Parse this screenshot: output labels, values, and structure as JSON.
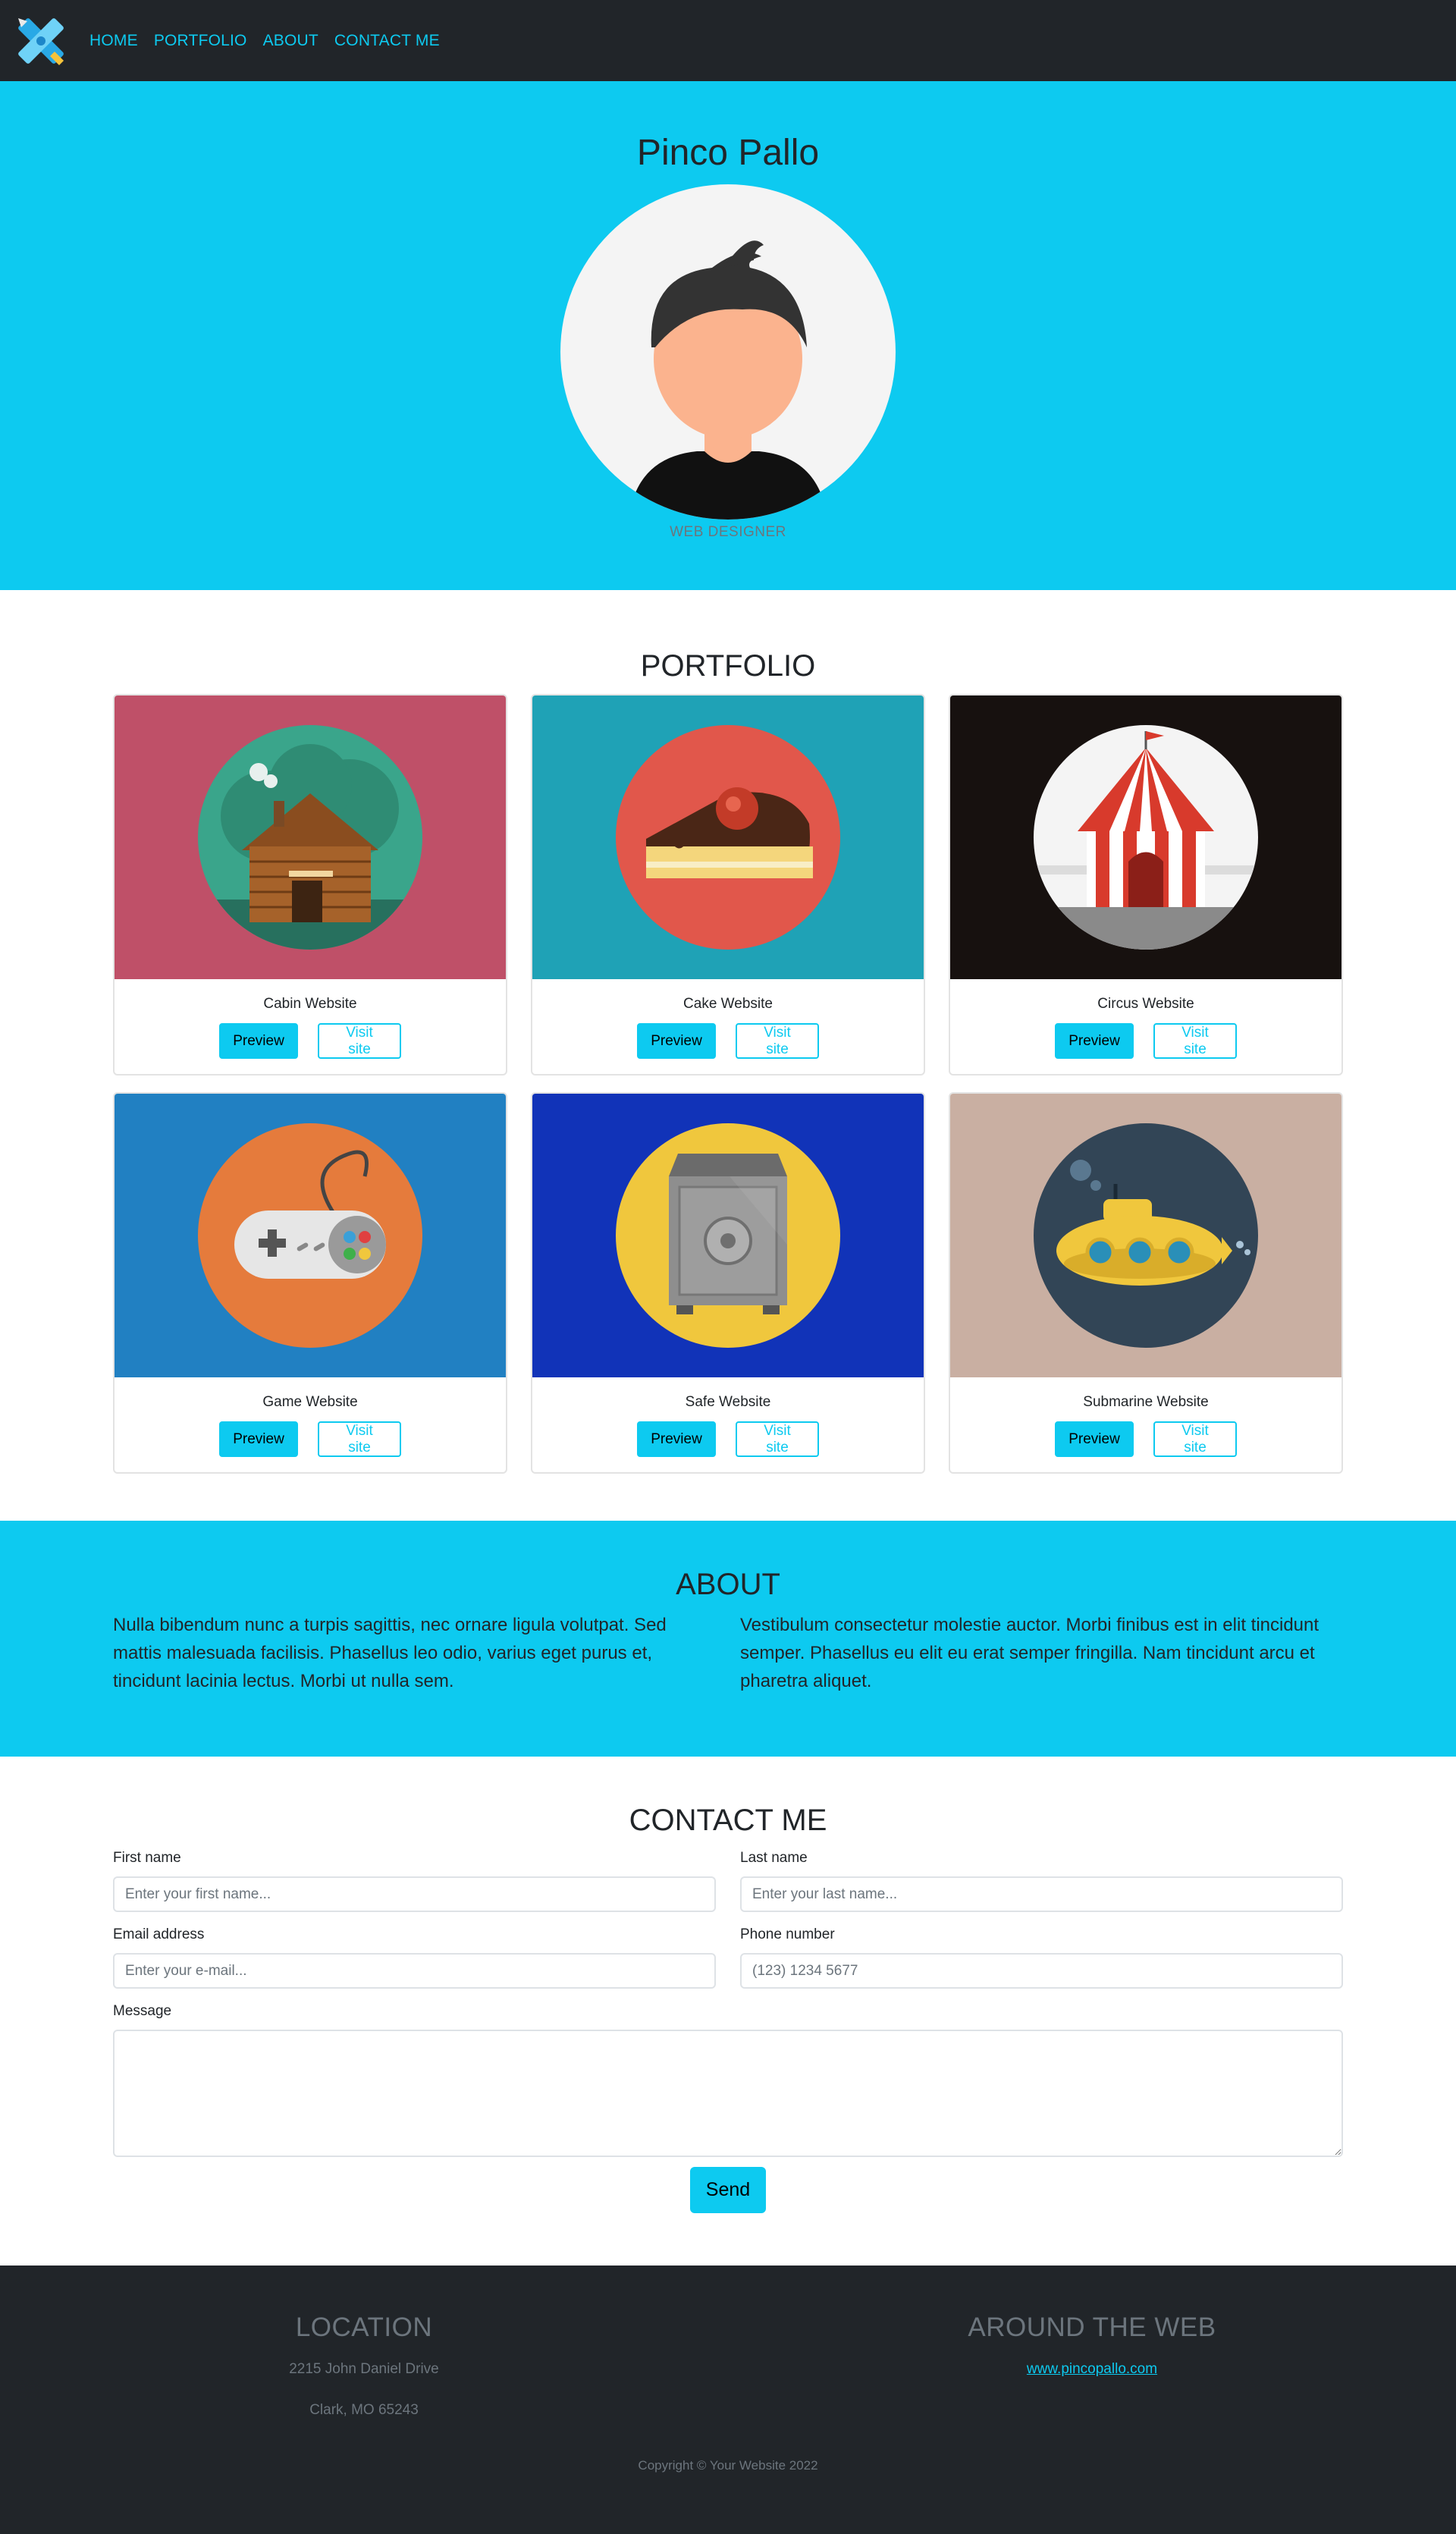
{
  "nav": {
    "logo": "design-tools-icon",
    "items": [
      "HOME",
      "PORTFOLIO",
      "ABOUT",
      "CONTACT ME"
    ]
  },
  "hero": {
    "name": "Pinco Pallo",
    "subtitle": "WEB DESIGNER",
    "avatar": "person-avatar-icon"
  },
  "portfolio": {
    "title": "PORTFOLIO",
    "preview_label": "Preview",
    "visit_label": "Visit site",
    "items": [
      {
        "title": "Cabin Website",
        "icon": "log-cabin-icon",
        "bg": "#bf5068",
        "circle": "#3aa58b"
      },
      {
        "title": "Cake Website",
        "icon": "cake-slice-icon",
        "bg": "#1fa2b6",
        "circle": "#e1574b"
      },
      {
        "title": "Circus Website",
        "icon": "circus-tent-icon",
        "bg": "#17110f",
        "circle": "#f4f4f4"
      },
      {
        "title": "Game Website",
        "icon": "game-controller-icon",
        "bg": "#2180c2",
        "circle": "#e57b3c"
      },
      {
        "title": "Safe Website",
        "icon": "safe-icon",
        "bg": "#1133b8",
        "circle": "#f0c73d"
      },
      {
        "title": "Submarine Website",
        "icon": "submarine-icon",
        "bg": "#c9afa2",
        "circle": "#324556"
      }
    ]
  },
  "about": {
    "title": "ABOUT",
    "left": "Nulla bibendum nunc a turpis sagittis, nec ornare ligula volutpat. Sed mattis malesuada facilisis. Phasellus leo odio, varius eget purus et, tincidunt lacinia lectus. Morbi ut nulla sem.",
    "right": "Vestibulum consectetur molestie auctor. Morbi finibus est in elit tincidunt semper. Phasellus eu elit eu erat semper fringilla. Nam tincidunt arcu et pharetra aliquet."
  },
  "contact": {
    "title": "CONTACT ME",
    "first_name_label": "First name",
    "first_name_placeholder": "Enter your first name...",
    "last_name_label": "Last name",
    "last_name_placeholder": "Enter your last name...",
    "email_label": "Email address",
    "email_placeholder": "Enter your e-mail...",
    "phone_label": "Phone number",
    "phone_placeholder": "(123) 1234 5677",
    "message_label": "Message",
    "send_label": "Send"
  },
  "footer": {
    "location_title": "LOCATION",
    "address_line1": "2215 John Daniel Drive",
    "address_line2": "Clark, MO 65243",
    "web_title": "AROUND THE WEB",
    "web_link": "www.pincopallo.com",
    "copyright": "Copyright © Your Website 2022"
  },
  "colors": {
    "accent": "#0dcaf0",
    "dark": "#212529",
    "muted": "#6c757d"
  }
}
